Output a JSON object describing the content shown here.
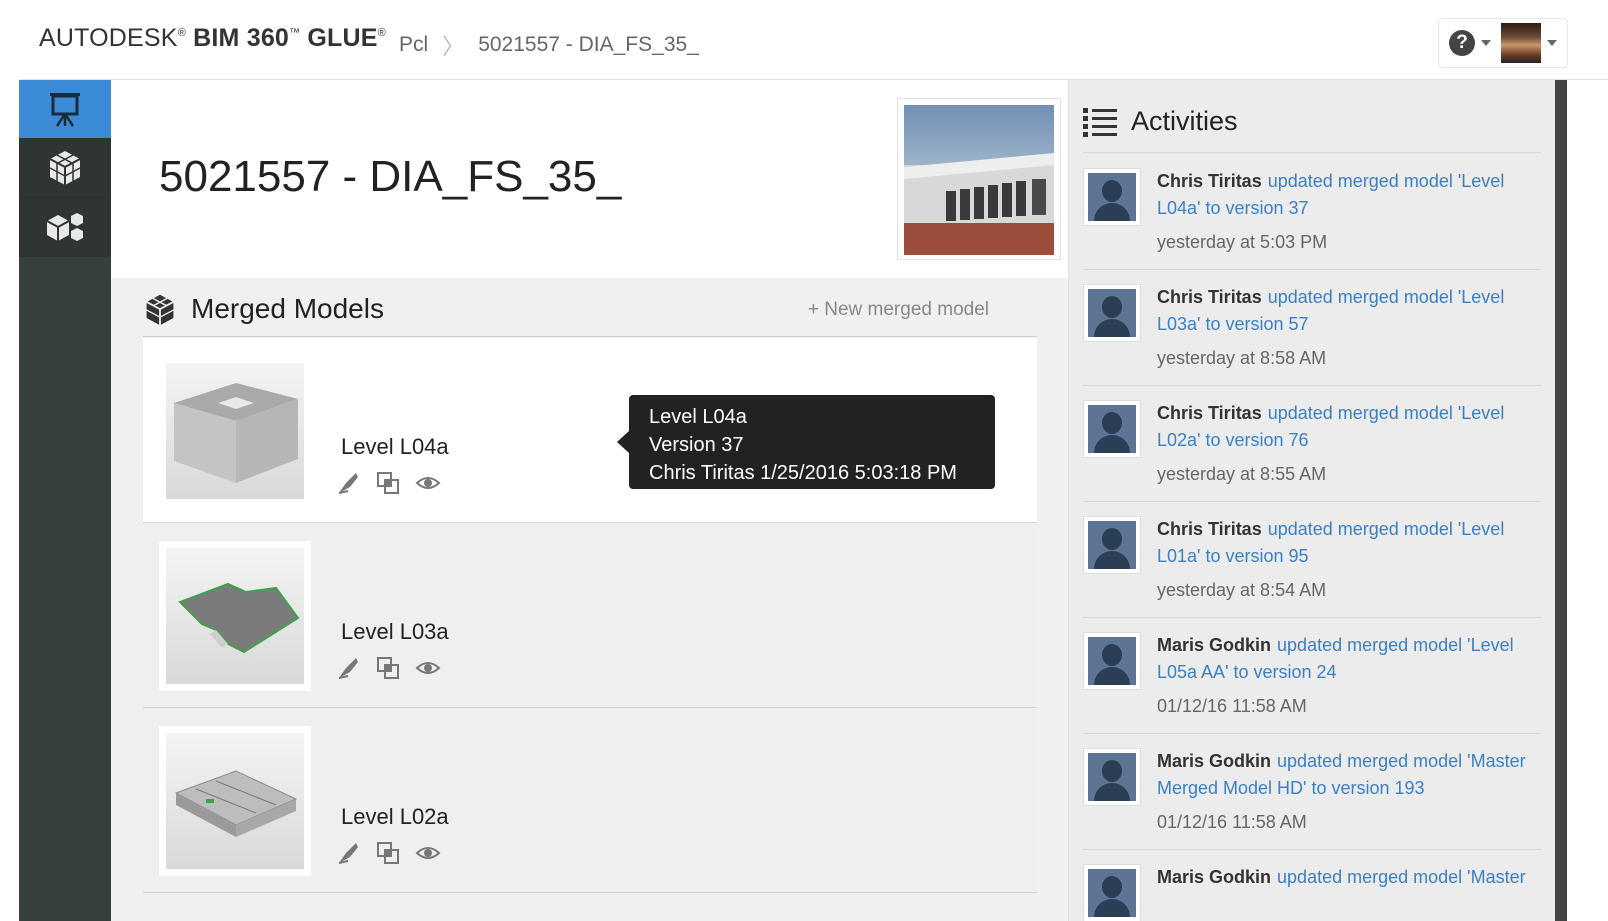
{
  "app": {
    "brand_prefix": "AUTODESK",
    "brand_product": "BIM 360",
    "brand_suffix": "GLUE",
    "reg_mark": "®",
    "tm_mark": "™"
  },
  "breadcrumb": {
    "items": [
      "Pcl",
      "5021557 - DIA_FS_35_"
    ],
    "separator": "〉"
  },
  "header": {
    "help_label": "?"
  },
  "project": {
    "title": "5021557 - DIA_FS_35_"
  },
  "merged_models": {
    "section_title": "Merged Models",
    "new_label": "+ New merged model",
    "items": [
      {
        "name": "Level L04a"
      },
      {
        "name": "Level L03a"
      },
      {
        "name": "Level L02a"
      }
    ],
    "tooltip": {
      "line1": "Level L04a",
      "line2": "Version  37",
      "line3": "Chris Tiritas 1/25/2016 5:03:18 PM"
    }
  },
  "activities": {
    "title": "Activities",
    "items": [
      {
        "user": "Chris Tiritas",
        "text": "updated merged model 'Level L04a' to version 37",
        "time": "yesterday at 5:03 PM"
      },
      {
        "user": "Chris Tiritas",
        "text": "updated merged model 'Level L03a' to version 57",
        "time": "yesterday at 8:58 AM"
      },
      {
        "user": "Chris Tiritas",
        "text": "updated merged model 'Level L02a' to version 76",
        "time": "yesterday at 8:55 AM"
      },
      {
        "user": "Chris Tiritas",
        "text": "updated merged model 'Level L01a' to version 95",
        "time": "yesterday at 8:54 AM"
      },
      {
        "user": "Maris Godkin",
        "text": "updated merged model 'Level L05a AA' to version 24",
        "time": "01/12/16 11:58 AM"
      },
      {
        "user": "Maris Godkin",
        "text": "updated merged model 'Master Merged Model HD' to version 193",
        "time": "01/12/16 11:58 AM"
      },
      {
        "user": "Maris Godkin",
        "text": "updated merged model 'Master",
        "time": ""
      }
    ]
  },
  "colors": {
    "accent": "#3c8bd6",
    "rail_bg": "#37403d",
    "link": "#3b7fc4",
    "tooltip_bg": "#222222"
  }
}
